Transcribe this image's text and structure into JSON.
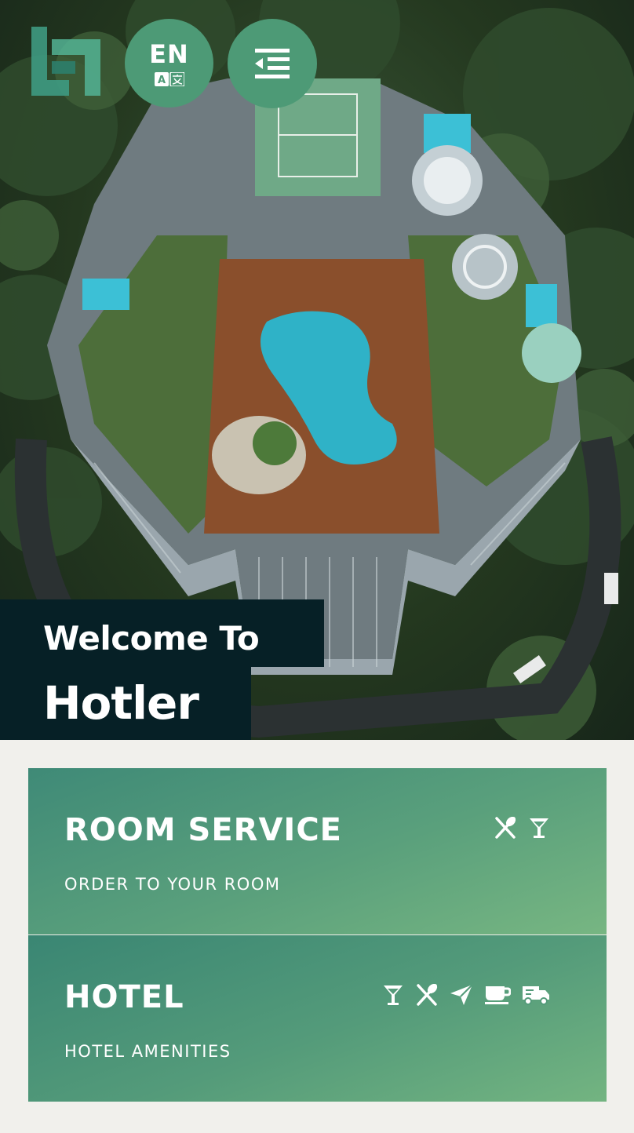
{
  "header": {
    "language_code": "EN",
    "logo_icon": "hotler-logo",
    "language_icon": "translate-icon",
    "menu_icon": "menu-indent-icon"
  },
  "hero": {
    "welcome_text": "Welcome To",
    "hotel_name": "Hotler"
  },
  "cards": [
    {
      "title": "ROOM SERVICE",
      "subtitle": "ORDER TO YOUR ROOM",
      "icons": [
        "utensils-icon",
        "cocktail-icon"
      ]
    },
    {
      "title": "HOTEL",
      "subtitle": "HOTEL AMENITIES",
      "icons": [
        "cocktail-icon",
        "utensils-icon",
        "paper-plane-icon",
        "coffee-icon",
        "truck-icon"
      ]
    }
  ],
  "colors": {
    "accent_green": "#4d9a76",
    "dark_teal": "#062026",
    "background": "#f1f0ec"
  }
}
